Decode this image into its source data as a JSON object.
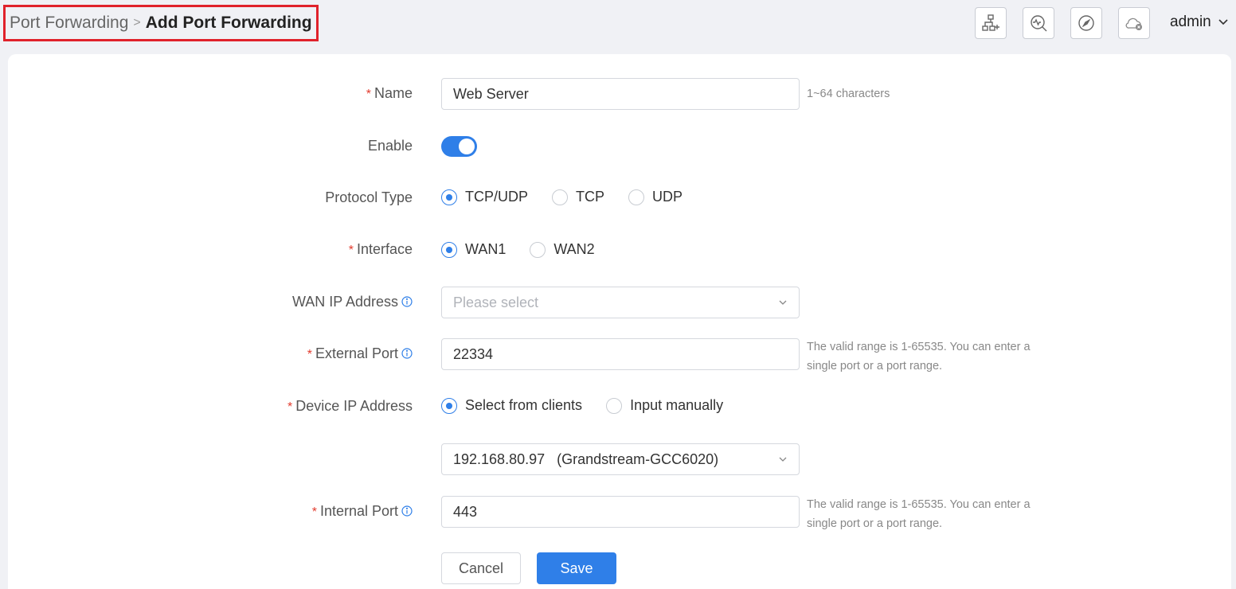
{
  "breadcrumb": {
    "parent": "Port Forwarding",
    "separator": ">",
    "current": "Add Port Forwarding"
  },
  "header": {
    "icons": [
      "network-add-icon",
      "diagnose-icon",
      "compass-icon",
      "cloud-offline-icon"
    ],
    "user": "admin"
  },
  "form": {
    "name": {
      "label": "Name",
      "required": true,
      "value": "Web Server",
      "hint": "1~64 characters"
    },
    "enable": {
      "label": "Enable",
      "value": true
    },
    "protocol": {
      "label": "Protocol Type",
      "options": [
        "TCP/UDP",
        "TCP",
        "UDP"
      ],
      "selected": "TCP/UDP"
    },
    "interface": {
      "label": "Interface",
      "required": true,
      "options": [
        "WAN1",
        "WAN2"
      ],
      "selected": "WAN1"
    },
    "wan_ip": {
      "label": "WAN IP Address",
      "placeholder": "Please select"
    },
    "external_port": {
      "label": "External Port",
      "required": true,
      "value": "22334",
      "hint_line1": "The valid range is 1-65535. You can enter a",
      "hint_line2": "single port or a port range."
    },
    "device_ip": {
      "label": "Device IP Address",
      "required": true,
      "options": [
        "Select from clients",
        "Input manually"
      ],
      "selected": "Select from clients",
      "client_value": "192.168.80.97   (Grandstream-GCC6020)"
    },
    "internal_port": {
      "label": "Internal Port",
      "required": true,
      "value": "443",
      "hint_line1": "The valid range is 1-65535. You can enter a",
      "hint_line2": "single port or a port range."
    },
    "required_mark": "*",
    "cancel_label": "Cancel",
    "save_label": "Save"
  },
  "colors": {
    "accent": "#2f7fe8",
    "required": "#e23b2e",
    "highlight": "#e0222b"
  }
}
